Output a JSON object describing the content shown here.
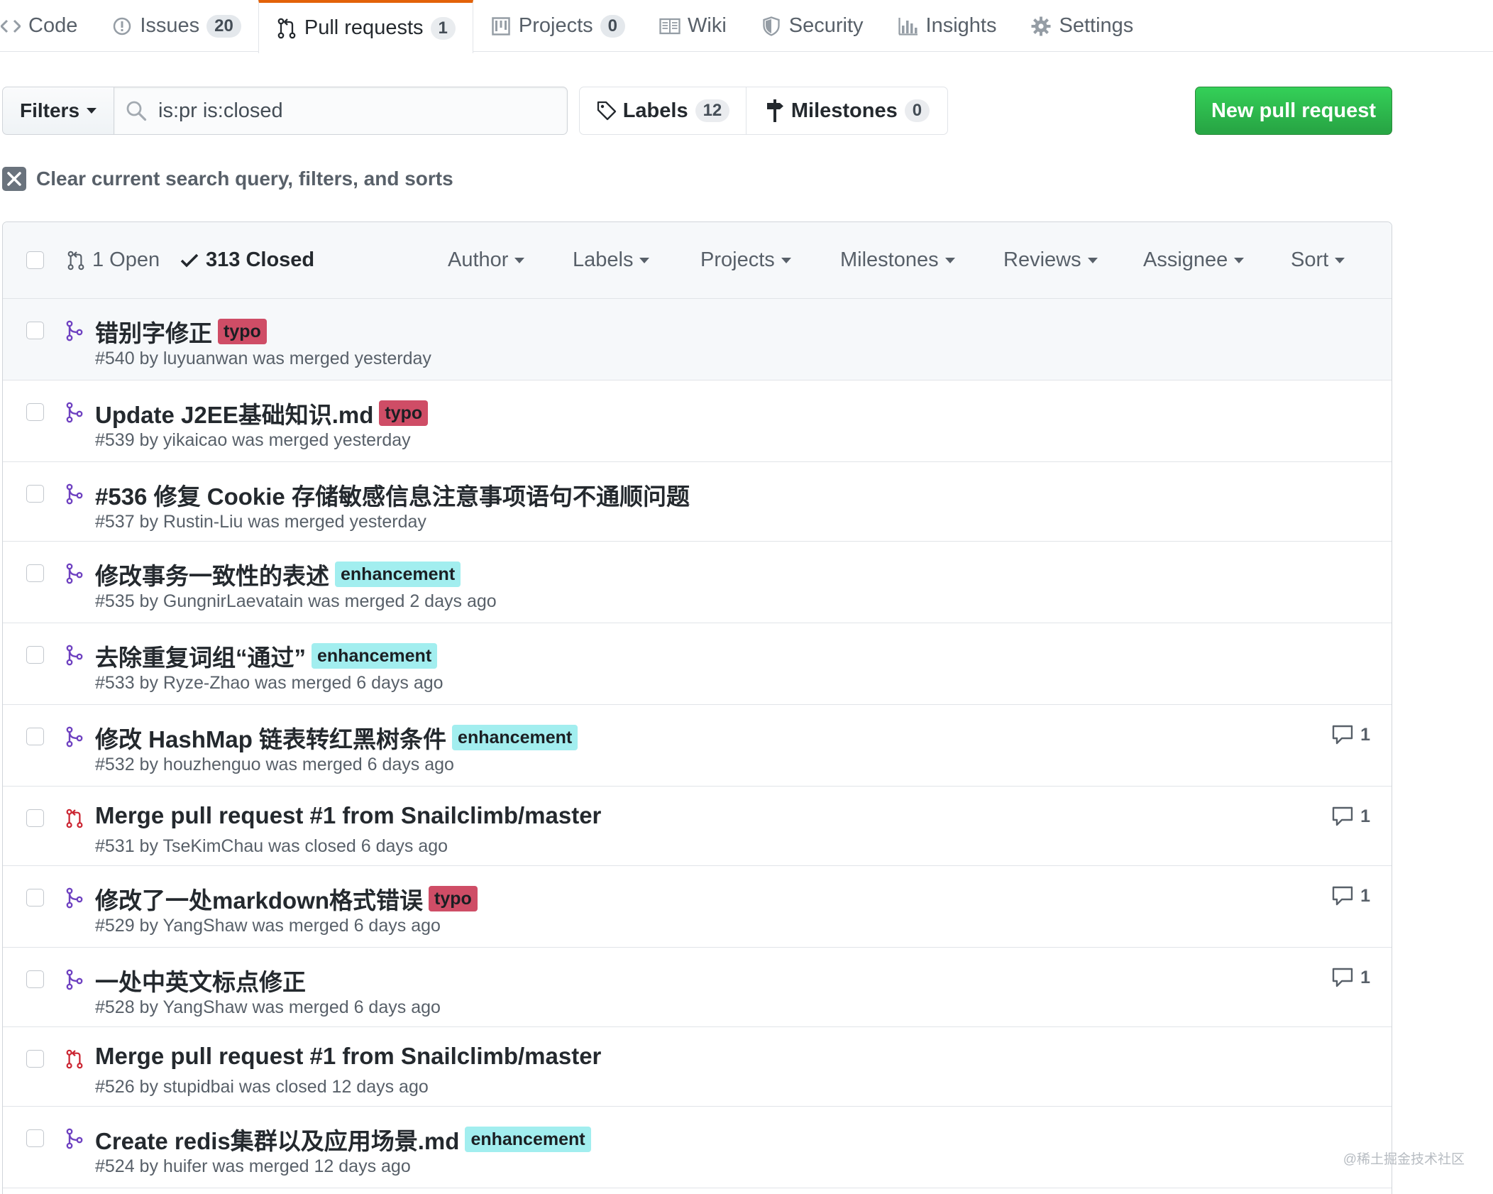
{
  "reponav": {
    "items": [
      {
        "label": "Code",
        "icon": "code-icon",
        "count": null
      },
      {
        "label": "Issues",
        "icon": "issue-icon",
        "count": "20"
      },
      {
        "label": "Pull requests",
        "icon": "git-pull-request-icon",
        "count": "1"
      },
      {
        "label": "Projects",
        "icon": "project-icon",
        "count": "0"
      },
      {
        "label": "Wiki",
        "icon": "book-icon",
        "count": null
      },
      {
        "label": "Security",
        "icon": "shield-icon",
        "count": null
      },
      {
        "label": "Insights",
        "icon": "graph-icon",
        "count": null
      },
      {
        "label": "Settings",
        "icon": "gear-icon",
        "count": null
      }
    ],
    "selected": "Pull requests"
  },
  "subnav": {
    "filters_label": "Filters",
    "search_value": "is:pr is:closed",
    "labels_label": "Labels",
    "labels_count": "12",
    "milestones_label": "Milestones",
    "milestones_count": "0",
    "new_pr_label": "New pull request",
    "clear_label": "Clear current search query, filters, and sorts"
  },
  "header": {
    "open_label": "1 Open",
    "closed_label": "313 Closed",
    "filters": [
      "Author",
      "Labels",
      "Projects",
      "Milestones",
      "Reviews",
      "Assignee",
      "Sort"
    ]
  },
  "pull_requests": [
    {
      "title": "错别字修正",
      "label": "typo",
      "meta": "#540 by luyuanwan was merged yesterday",
      "state": "merged",
      "comments": null
    },
    {
      "title": "Update J2EE基础知识.md",
      "label": "typo",
      "meta": "#539 by yikaicao was merged yesterday",
      "state": "merged",
      "comments": null
    },
    {
      "title": "#536 修复 Cookie 存储敏感信息注意事项语句不通顺问题",
      "label": null,
      "meta": "#537 by Rustin-Liu was merged yesterday",
      "state": "merged",
      "comments": null
    },
    {
      "title": "修改事务一致性的表述",
      "label": "enhancement",
      "meta": "#535 by GungnirLaevatain was merged 2 days ago",
      "state": "merged",
      "comments": null
    },
    {
      "title": "去除重复词组“通过”",
      "label": "enhancement",
      "meta": "#533 by Ryze-Zhao was merged 6 days ago",
      "state": "merged",
      "comments": null
    },
    {
      "title": "修改 HashMap 链表转红黑树条件",
      "label": "enhancement",
      "meta": "#532 by houzhenguo was merged 6 days ago",
      "state": "merged",
      "comments": "1"
    },
    {
      "title": "Merge pull request #1 from Snailclimb/master",
      "label": null,
      "meta": "#531 by TseKimChau was closed 6 days ago",
      "state": "closed",
      "comments": "1"
    },
    {
      "title": "修改了一处markdown格式错误",
      "label": "typo",
      "meta": "#529 by YangShaw was merged 6 days ago",
      "state": "merged",
      "comments": "1"
    },
    {
      "title": "一处中英文标点修正",
      "label": null,
      "meta": "#528 by YangShaw was merged 6 days ago",
      "state": "merged",
      "comments": "1"
    },
    {
      "title": "Merge pull request #1 from Snailclimb/master",
      "label": null,
      "meta": "#526 by stupidbai was closed 12 days ago",
      "state": "closed",
      "comments": null
    },
    {
      "title": "Create redis集群以及应用场景.md",
      "label": "enhancement",
      "meta": "#524 by huifer was merged 12 days ago",
      "state": "merged",
      "comments": null
    }
  ],
  "colors": {
    "merged": "#6f42c1",
    "closed": "#cb2431",
    "typo_label": "#cf4d66",
    "enhancement_label": "#a2eeef",
    "primary_button": "#28a745",
    "selected_tab_accent": "#e36209"
  },
  "watermark": "@稀土掘金技术社区"
}
